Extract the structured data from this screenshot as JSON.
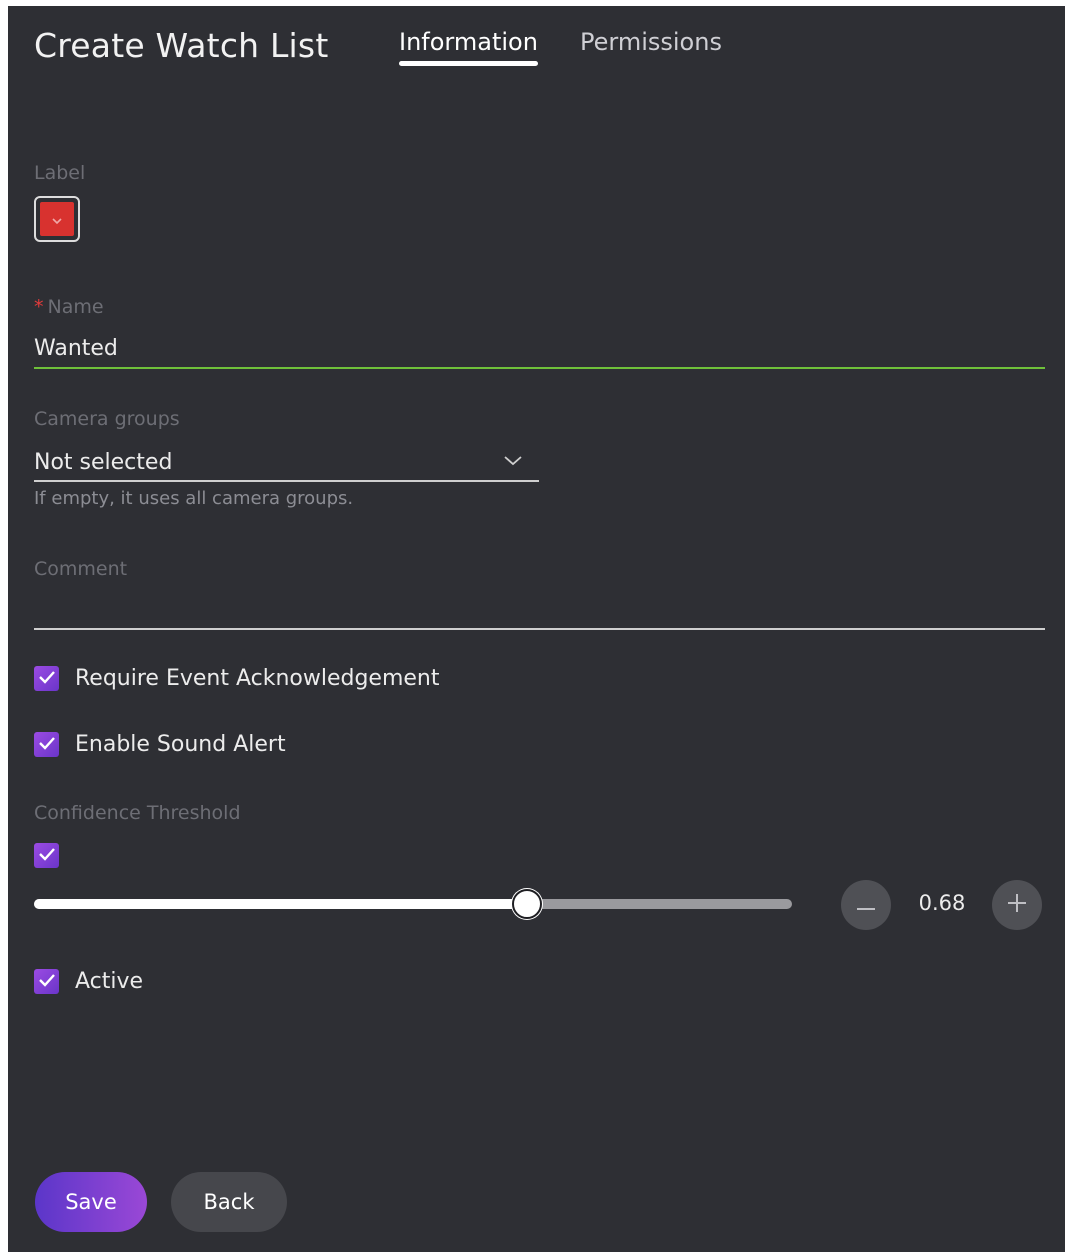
{
  "header": {
    "title": "Create Watch List",
    "tabs": [
      {
        "label": "Information",
        "active": true
      },
      {
        "label": "Permissions",
        "active": false
      }
    ]
  },
  "form": {
    "label_field": {
      "label": "Label",
      "selected_color": "#d8322f",
      "icon": "chevron-down-icon"
    },
    "name_field": {
      "required_marker": "*",
      "label": "Name",
      "value": "Wanted"
    },
    "camera_groups": {
      "label": "Camera groups",
      "value": "Not selected",
      "hint": "If empty, it uses all camera groups.",
      "icon": "chevron-down-icon"
    },
    "comment": {
      "label": "Comment",
      "value": ""
    },
    "require_ack": {
      "label": "Require Event Acknowledgement",
      "checked": true
    },
    "sound_alert": {
      "label": "Enable Sound Alert",
      "checked": true
    },
    "confidence": {
      "label": "Confidence Threshold",
      "checked": true,
      "value": "0.68",
      "slider_fraction": 0.65,
      "decrement_icon": "minus-icon",
      "increment_icon": "plus-icon"
    },
    "active": {
      "label": "Active",
      "checked": true
    }
  },
  "actions": {
    "save_label": "Save",
    "back_label": "Back"
  },
  "colors": {
    "background": "#2e2f34",
    "accent": "#7b3fd6",
    "name_underline": "#6fc13a"
  }
}
